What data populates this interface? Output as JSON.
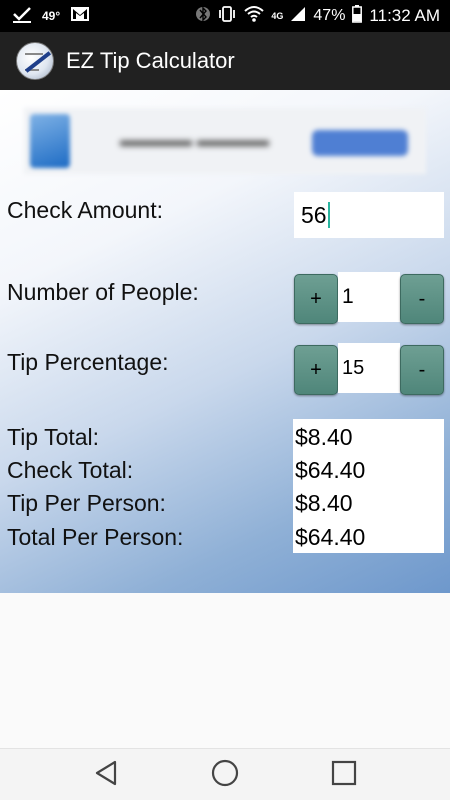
{
  "status_bar": {
    "temperature": "49°",
    "lte": "4G",
    "battery_pct": "47%",
    "time": "11:32 AM"
  },
  "app": {
    "title": "EZ Tip Calculator"
  },
  "form": {
    "check_amount_label": "Check Amount:",
    "check_amount_value": "56",
    "people_label": "Number of People:",
    "people_value": "1",
    "tip_pct_label": "Tip Percentage:",
    "tip_pct_value": "15",
    "plus_label": "+",
    "minus_label": "-"
  },
  "results": {
    "tip_total_label": "Tip Total:",
    "tip_total_value": "$8.40",
    "check_total_label": "Check Total:",
    "check_total_value": "$64.40",
    "tip_per_person_label": "Tip Per Person:",
    "tip_per_person_value": "$8.40",
    "total_per_person_label": "Total Per Person:",
    "total_per_person_value": "$64.40"
  },
  "colors": {
    "stepper_button": "#5a8f82",
    "cursor": "#2bb5a0",
    "gradient_dark": "#6e98cc"
  }
}
